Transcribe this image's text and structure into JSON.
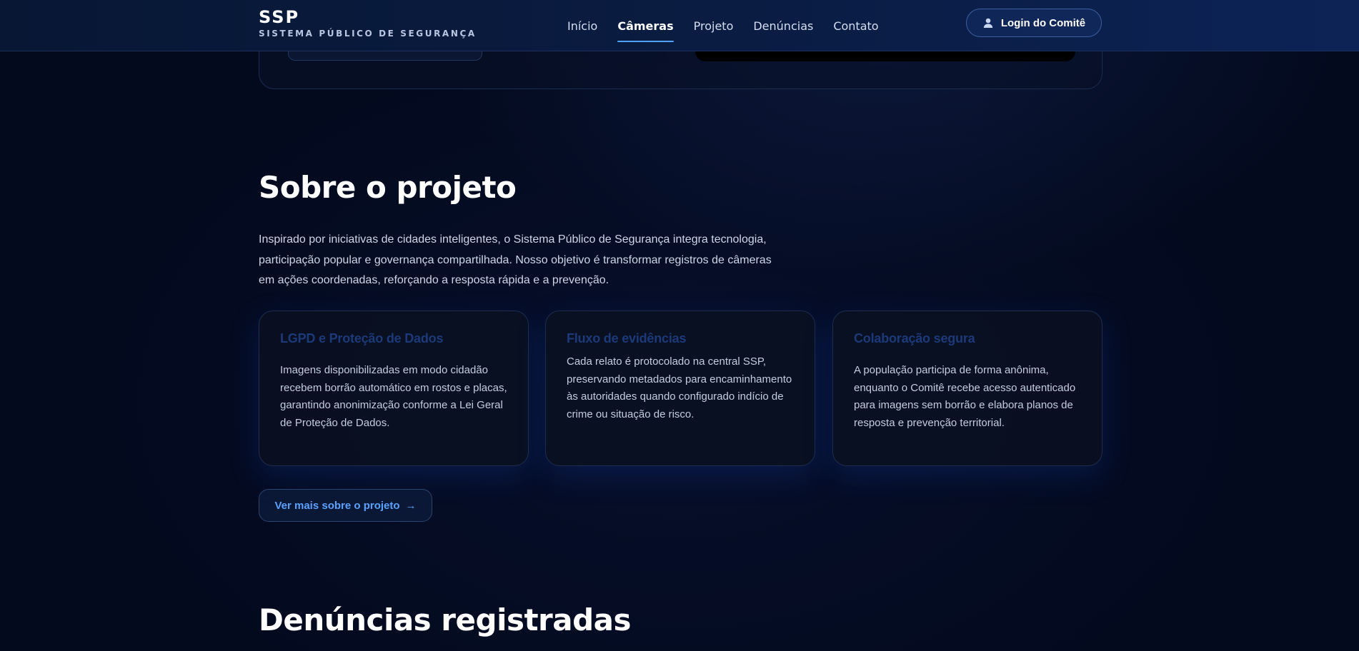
{
  "header": {
    "brand_title": "SSP",
    "brand_subtitle": "SISTEMA PÚBLICO DE SEGURANÇA",
    "nav": [
      {
        "label": "Início",
        "active": false
      },
      {
        "label": "Câmeras",
        "active": true
      },
      {
        "label": "Projeto",
        "active": false
      },
      {
        "label": "Denúncias",
        "active": false
      },
      {
        "label": "Contato",
        "active": false
      }
    ],
    "login_label": "Login do Comitê",
    "login_icon": "user-icon"
  },
  "about": {
    "title": "Sobre o projeto",
    "text": "Inspirado por iniciativas de cidades inteligentes, o Sistema Público de Segurança integra tecnologia, participação popular e governança compartilhada. Nosso objetivo é transformar registros de câmeras em ações coordenadas, reforçando a resposta rápida e a prevenção.",
    "cards": [
      {
        "title": "LGPD e Proteção de Dados",
        "text": "Imagens disponibilizadas em modo cidadão recebem borrão automático em rostos e placas, garantindo anonimização conforme a Lei Geral de Proteção de Dados."
      },
      {
        "title": "Fluxo de evidências",
        "text": "Cada relato é protocolado na central SSP, preservando metadados para encaminhamento às autoridades quando configurado indício de crime ou situação de risco."
      },
      {
        "title": "Colaboração segura",
        "text": "A população participa de forma anônima, enquanto o Comitê recebe acesso autenticado para imagens sem borrão e elabora planos de resposta e prevenção territorial."
      }
    ],
    "more_label": "Ver mais sobre o projeto",
    "more_arrow": "→"
  },
  "denuncias": {
    "title": "Denúncias registradas"
  },
  "colors": {
    "accent": "#4fa3ff",
    "link": "#5aa2ff",
    "card_title": "#1c3a7a",
    "background": "#030a1e"
  }
}
